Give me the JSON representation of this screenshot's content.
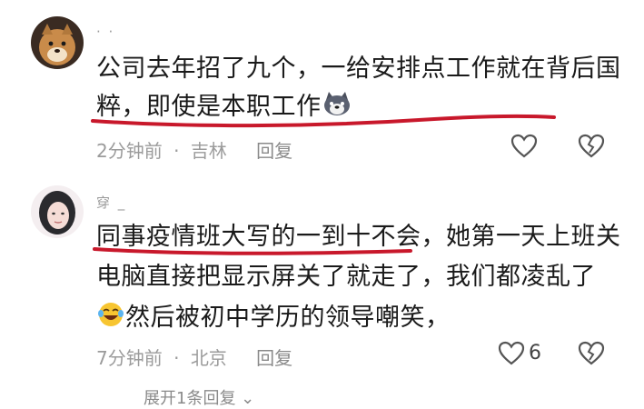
{
  "comments": [
    {
      "username": "· ·",
      "text_lines": [
        "公司去年招了九个，一给安排点工作就在背后国",
        "粹，即使是本职工作"
      ],
      "emoji": "dog-face",
      "time": "2分钟前",
      "location": "吉林",
      "reply_label": "回复",
      "like_count": ""
    },
    {
      "username": "穿 _",
      "text_lines": [
        "同事疫情班大写的一到十不会，她第一天上班关",
        "电脑直接把显示屏关了就走了，我们都凌乱了",
        "然后被初中学历的领导嘲笑，"
      ],
      "emoji": "laughing-tears",
      "time": "7分钟前",
      "location": "北京",
      "reply_label": "回复",
      "like_count": "6"
    }
  ],
  "expand_label": "展开1条回复 ⌄",
  "colors": {
    "highlight_red": "#c8182b",
    "meta_gray": "#9b9b9b"
  }
}
